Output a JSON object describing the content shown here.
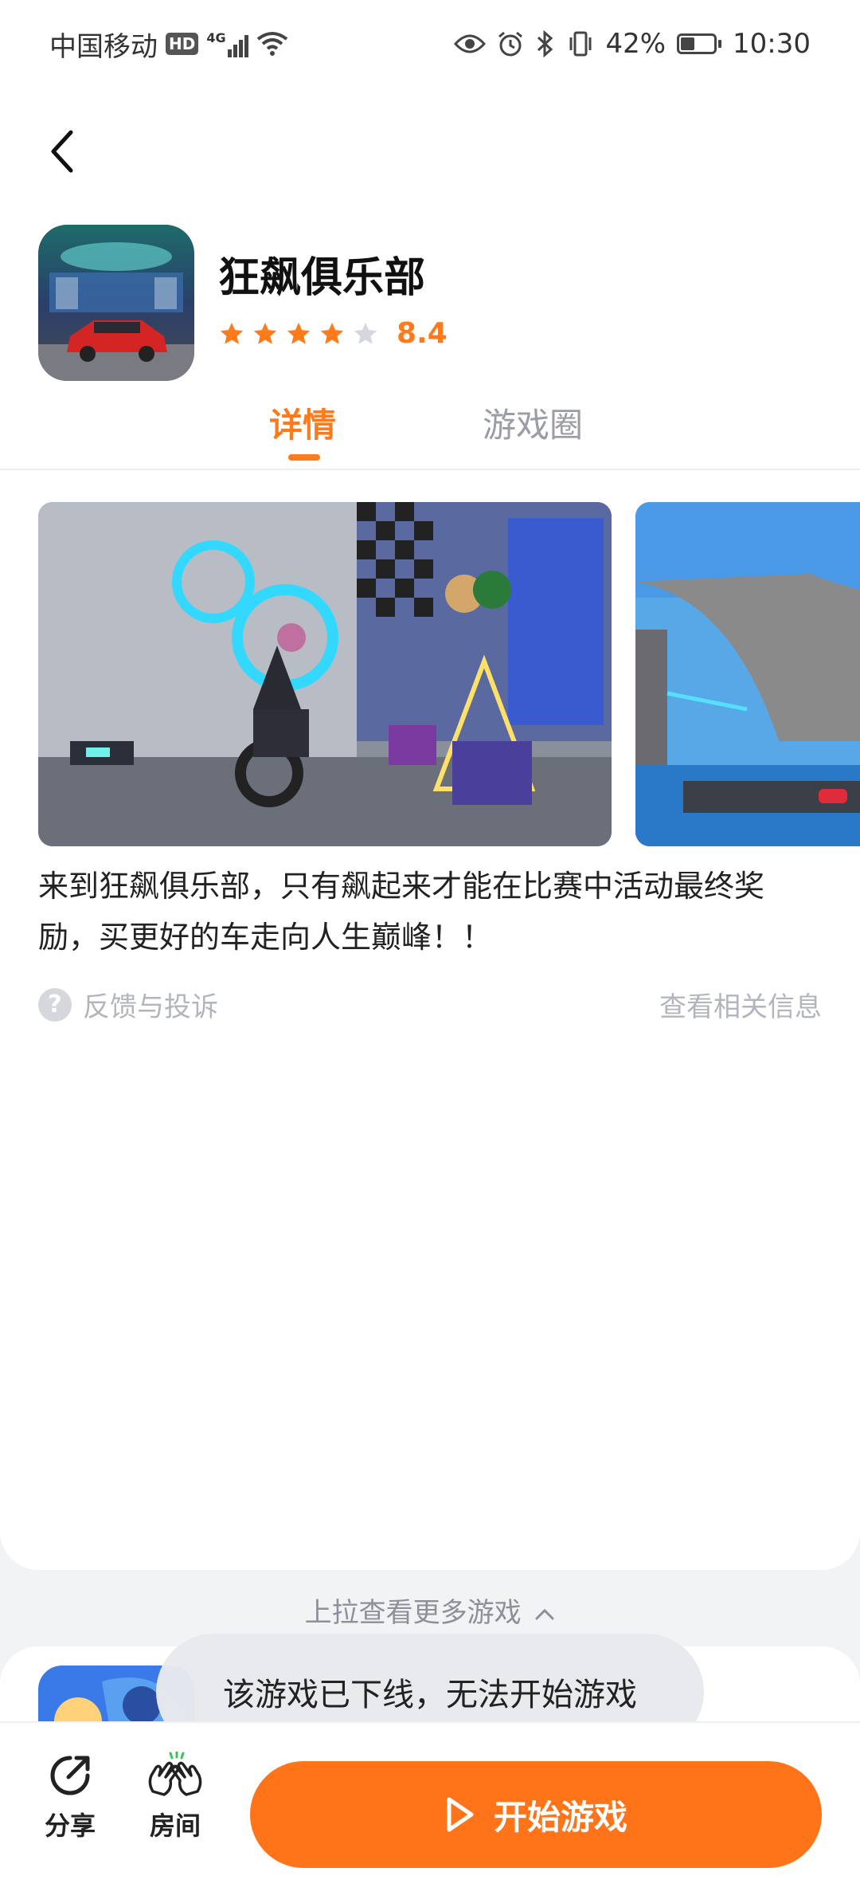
{
  "status_bar": {
    "carrier": "中国移动",
    "hd": "HD",
    "network": "4G",
    "battery_percent": "42%",
    "battery_level": 0.42,
    "time": "10:30"
  },
  "game": {
    "title": "狂飙俱乐部",
    "rating": "8.4",
    "stars_filled": 4,
    "stars_total": 5
  },
  "tabs": [
    {
      "label": "详情",
      "active": true
    },
    {
      "label": "游戏圈",
      "active": false
    }
  ],
  "description": "来到狂飙俱乐部，只有飙起来才能在比赛中活动最终奖励，买更好的车走向人生巅峰！！",
  "feedback": {
    "label": "反馈与投诉",
    "related": "查看相关信息"
  },
  "pull_hint": "上拉查看更多游戏",
  "toast": "该游戏已下线，无法开始游戏",
  "bottom_bar": {
    "share_label": "分享",
    "room_label": "房间",
    "start_label": "开始游戏"
  },
  "colors": {
    "accent": "#ff7a1a",
    "button": "#ff7418",
    "muted": "#b3b5bd"
  }
}
